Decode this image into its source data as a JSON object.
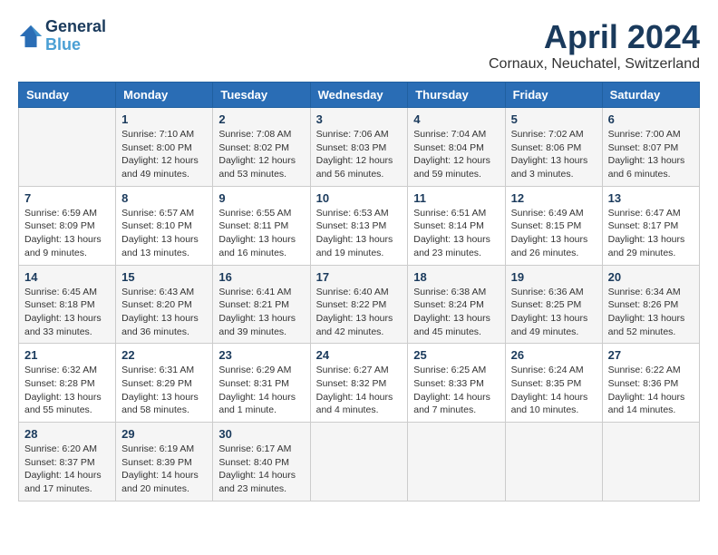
{
  "logo": {
    "line1": "General",
    "line2": "Blue"
  },
  "title": "April 2024",
  "location": "Cornaux, Neuchatel, Switzerland",
  "days_of_week": [
    "Sunday",
    "Monday",
    "Tuesday",
    "Wednesday",
    "Thursday",
    "Friday",
    "Saturday"
  ],
  "weeks": [
    [
      {
        "day": "",
        "sunrise": "",
        "sunset": "",
        "daylight": ""
      },
      {
        "day": "1",
        "sunrise": "Sunrise: 7:10 AM",
        "sunset": "Sunset: 8:00 PM",
        "daylight": "Daylight: 12 hours and 49 minutes."
      },
      {
        "day": "2",
        "sunrise": "Sunrise: 7:08 AM",
        "sunset": "Sunset: 8:02 PM",
        "daylight": "Daylight: 12 hours and 53 minutes."
      },
      {
        "day": "3",
        "sunrise": "Sunrise: 7:06 AM",
        "sunset": "Sunset: 8:03 PM",
        "daylight": "Daylight: 12 hours and 56 minutes."
      },
      {
        "day": "4",
        "sunrise": "Sunrise: 7:04 AM",
        "sunset": "Sunset: 8:04 PM",
        "daylight": "Daylight: 12 hours and 59 minutes."
      },
      {
        "day": "5",
        "sunrise": "Sunrise: 7:02 AM",
        "sunset": "Sunset: 8:06 PM",
        "daylight": "Daylight: 13 hours and 3 minutes."
      },
      {
        "day": "6",
        "sunrise": "Sunrise: 7:00 AM",
        "sunset": "Sunset: 8:07 PM",
        "daylight": "Daylight: 13 hours and 6 minutes."
      }
    ],
    [
      {
        "day": "7",
        "sunrise": "Sunrise: 6:59 AM",
        "sunset": "Sunset: 8:09 PM",
        "daylight": "Daylight: 13 hours and 9 minutes."
      },
      {
        "day": "8",
        "sunrise": "Sunrise: 6:57 AM",
        "sunset": "Sunset: 8:10 PM",
        "daylight": "Daylight: 13 hours and 13 minutes."
      },
      {
        "day": "9",
        "sunrise": "Sunrise: 6:55 AM",
        "sunset": "Sunset: 8:11 PM",
        "daylight": "Daylight: 13 hours and 16 minutes."
      },
      {
        "day": "10",
        "sunrise": "Sunrise: 6:53 AM",
        "sunset": "Sunset: 8:13 PM",
        "daylight": "Daylight: 13 hours and 19 minutes."
      },
      {
        "day": "11",
        "sunrise": "Sunrise: 6:51 AM",
        "sunset": "Sunset: 8:14 PM",
        "daylight": "Daylight: 13 hours and 23 minutes."
      },
      {
        "day": "12",
        "sunrise": "Sunrise: 6:49 AM",
        "sunset": "Sunset: 8:15 PM",
        "daylight": "Daylight: 13 hours and 26 minutes."
      },
      {
        "day": "13",
        "sunrise": "Sunrise: 6:47 AM",
        "sunset": "Sunset: 8:17 PM",
        "daylight": "Daylight: 13 hours and 29 minutes."
      }
    ],
    [
      {
        "day": "14",
        "sunrise": "Sunrise: 6:45 AM",
        "sunset": "Sunset: 8:18 PM",
        "daylight": "Daylight: 13 hours and 33 minutes."
      },
      {
        "day": "15",
        "sunrise": "Sunrise: 6:43 AM",
        "sunset": "Sunset: 8:20 PM",
        "daylight": "Daylight: 13 hours and 36 minutes."
      },
      {
        "day": "16",
        "sunrise": "Sunrise: 6:41 AM",
        "sunset": "Sunset: 8:21 PM",
        "daylight": "Daylight: 13 hours and 39 minutes."
      },
      {
        "day": "17",
        "sunrise": "Sunrise: 6:40 AM",
        "sunset": "Sunset: 8:22 PM",
        "daylight": "Daylight: 13 hours and 42 minutes."
      },
      {
        "day": "18",
        "sunrise": "Sunrise: 6:38 AM",
        "sunset": "Sunset: 8:24 PM",
        "daylight": "Daylight: 13 hours and 45 minutes."
      },
      {
        "day": "19",
        "sunrise": "Sunrise: 6:36 AM",
        "sunset": "Sunset: 8:25 PM",
        "daylight": "Daylight: 13 hours and 49 minutes."
      },
      {
        "day": "20",
        "sunrise": "Sunrise: 6:34 AM",
        "sunset": "Sunset: 8:26 PM",
        "daylight": "Daylight: 13 hours and 52 minutes."
      }
    ],
    [
      {
        "day": "21",
        "sunrise": "Sunrise: 6:32 AM",
        "sunset": "Sunset: 8:28 PM",
        "daylight": "Daylight: 13 hours and 55 minutes."
      },
      {
        "day": "22",
        "sunrise": "Sunrise: 6:31 AM",
        "sunset": "Sunset: 8:29 PM",
        "daylight": "Daylight: 13 hours and 58 minutes."
      },
      {
        "day": "23",
        "sunrise": "Sunrise: 6:29 AM",
        "sunset": "Sunset: 8:31 PM",
        "daylight": "Daylight: 14 hours and 1 minute."
      },
      {
        "day": "24",
        "sunrise": "Sunrise: 6:27 AM",
        "sunset": "Sunset: 8:32 PM",
        "daylight": "Daylight: 14 hours and 4 minutes."
      },
      {
        "day": "25",
        "sunrise": "Sunrise: 6:25 AM",
        "sunset": "Sunset: 8:33 PM",
        "daylight": "Daylight: 14 hours and 7 minutes."
      },
      {
        "day": "26",
        "sunrise": "Sunrise: 6:24 AM",
        "sunset": "Sunset: 8:35 PM",
        "daylight": "Daylight: 14 hours and 10 minutes."
      },
      {
        "day": "27",
        "sunrise": "Sunrise: 6:22 AM",
        "sunset": "Sunset: 8:36 PM",
        "daylight": "Daylight: 14 hours and 14 minutes."
      }
    ],
    [
      {
        "day": "28",
        "sunrise": "Sunrise: 6:20 AM",
        "sunset": "Sunset: 8:37 PM",
        "daylight": "Daylight: 14 hours and 17 minutes."
      },
      {
        "day": "29",
        "sunrise": "Sunrise: 6:19 AM",
        "sunset": "Sunset: 8:39 PM",
        "daylight": "Daylight: 14 hours and 20 minutes."
      },
      {
        "day": "30",
        "sunrise": "Sunrise: 6:17 AM",
        "sunset": "Sunset: 8:40 PM",
        "daylight": "Daylight: 14 hours and 23 minutes."
      },
      {
        "day": "",
        "sunrise": "",
        "sunset": "",
        "daylight": ""
      },
      {
        "day": "",
        "sunrise": "",
        "sunset": "",
        "daylight": ""
      },
      {
        "day": "",
        "sunrise": "",
        "sunset": "",
        "daylight": ""
      },
      {
        "day": "",
        "sunrise": "",
        "sunset": "",
        "daylight": ""
      }
    ]
  ]
}
